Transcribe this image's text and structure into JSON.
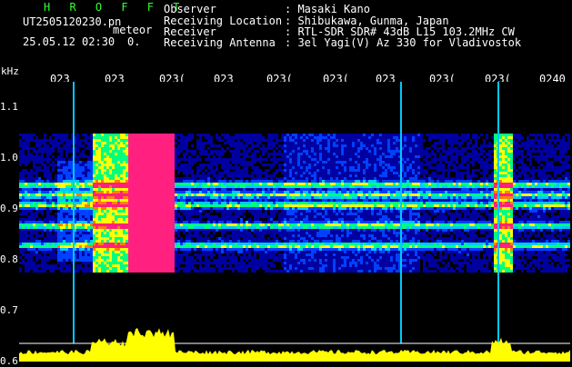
{
  "header": {
    "app_name": "H R O F F T",
    "file_name": "UT2505120230.pn",
    "file_suffix": "meteor",
    "date_time": "25.05.12 02:30",
    "count": "0.",
    "observer_label": "Observer",
    "observer_value": ": Masaki Kano",
    "location_label": "Receiving Location",
    "location_value": ": Shibukawa, Gunma, Japan",
    "receiver_label": "Receiver",
    "receiver_value": ": RTL-SDR SDR# 43dB L15 103.2MHz CW",
    "antenna_label": "Receiving Antenna",
    "antenna_value": ": 3el Yagi(V) Az 330 for Vladivostok"
  },
  "chart_data": {
    "type": "heatmap",
    "ylabel": "kHz",
    "y_ticks": [
      "1.1",
      "1.0",
      "0.9",
      "0.8",
      "0.7",
      "0.6"
    ],
    "ylim": [
      0.6,
      1.15
    ],
    "x_ticks": [
      "023",
      "023",
      "023(",
      "023",
      "023(",
      "023(",
      "023",
      "023(",
      "023(",
      "0240"
    ],
    "bands": [
      0.95,
      0.93,
      0.91,
      0.87,
      0.83
    ],
    "colors": {
      "low": "#0000a0",
      "mid": "#00c8ff",
      "high": "#ffff00",
      "peak": "#ff2080",
      "amplitude": "#ffff00",
      "grid": "#ffffff"
    }
  }
}
